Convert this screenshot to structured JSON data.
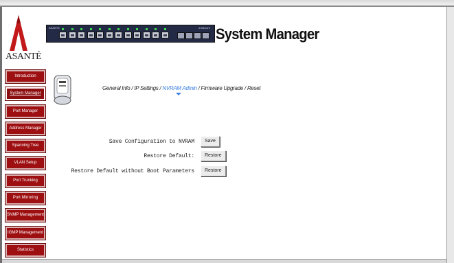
{
  "brand": {
    "logo_text": "ASANTÉ"
  },
  "header": {
    "title": "System Manager",
    "switch_label_left": "ASANTE",
    "switch_label_right": "IntraCore"
  },
  "sidebar": {
    "items": [
      {
        "label": "Introduction",
        "active": false
      },
      {
        "label": "System Manager",
        "active": true
      },
      {
        "label": "Port Manager",
        "active": false
      },
      {
        "label": "Address Manager",
        "active": false
      },
      {
        "label": "Spanning Tree",
        "active": false
      },
      {
        "label": "VLAN Setup",
        "active": false
      },
      {
        "label": "Port Trunking",
        "active": false
      },
      {
        "label": "Port Mirroring",
        "active": false
      },
      {
        "label": "SNMP Management",
        "active": false
      },
      {
        "label": "IGMP Management",
        "active": false
      },
      {
        "label": "Statistics",
        "active": false
      }
    ]
  },
  "breadcrumb": {
    "items": [
      "General Info",
      "IP Settings",
      "NVRAM Admin",
      "Firmware Upgrade",
      "Reset"
    ],
    "current_index": 2,
    "separator": "/"
  },
  "actions": [
    {
      "label": "Save Configuration to NVRAM",
      "button": "Save"
    },
    {
      "label": "Restore Default:",
      "button": "Restore"
    },
    {
      "label": "Restore Default without Boot Parameters",
      "button": "Restore"
    }
  ],
  "colors": {
    "sidebar_button": "#9e0f12",
    "breadcrumb_current": "#3a7ee0",
    "switch_panel": "#232a45"
  }
}
